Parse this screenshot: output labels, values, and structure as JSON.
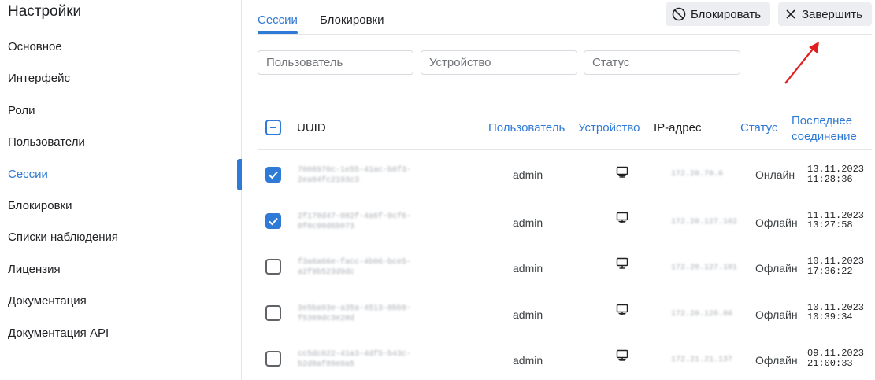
{
  "sidebar": {
    "title": "Настройки",
    "items": [
      {
        "label": "Основное"
      },
      {
        "label": "Интерфейс"
      },
      {
        "label": "Роли"
      },
      {
        "label": "Пользователи"
      },
      {
        "label": "Сессии",
        "active": true
      },
      {
        "label": "Блокировки"
      },
      {
        "label": "Списки наблюдения"
      },
      {
        "label": "Лицензия"
      },
      {
        "label": "Документация"
      },
      {
        "label": "Документация API"
      }
    ]
  },
  "tabs": [
    {
      "label": "Сессии",
      "active": true
    },
    {
      "label": "Блокировки"
    }
  ],
  "toolbar": {
    "block_label": "Блокировать",
    "finish_label": "Завершить"
  },
  "filters": {
    "user_placeholder": "Пользователь",
    "device_placeholder": "Устройство",
    "status_placeholder": "Статус"
  },
  "table": {
    "columns": {
      "uuid": "UUID",
      "user": "Пользователь",
      "device": "Устройство",
      "ip": "IP-адрес",
      "status": "Статус",
      "last_line1": "Последнее",
      "last_line2": "соединение"
    },
    "rows": [
      {
        "checked": true,
        "uuid": "7008970c-1e55-41ac-b8f3-\n2ea04fc2193c3",
        "user": "admin",
        "device_icon": "monitor-icon",
        "ip": "172.20.70.6",
        "status": "Онлайн",
        "date": "13.11.2023",
        "time": "11:28:36"
      },
      {
        "checked": true,
        "uuid": "2f170d47-082f-4a6f-9cf6-\n0f0c90d6b073",
        "user": "admin",
        "device_icon": "monitor-icon",
        "ip": "172.20.127.102",
        "status": "Офлайн",
        "date": "11.11.2023",
        "time": "13:27:58"
      },
      {
        "checked": false,
        "uuid": "f3a6a66e-facc-4b06-bce5-\na2f9b523d9dc",
        "user": "admin",
        "device_icon": "monitor-icon",
        "ip": "172.20.127.101",
        "status": "Офлайн",
        "date": "10.11.2023",
        "time": "17:36:22"
      },
      {
        "checked": false,
        "uuid": "3e5ba93e-a35a-4513-8bb9-\nf5369dc3e28d",
        "user": "admin",
        "device_icon": "monitor-icon",
        "ip": "172.20.120.86",
        "status": "Офлайн",
        "date": "10.11.2023",
        "time": "10:39:34"
      },
      {
        "checked": false,
        "uuid": "cc5dc022-41a3-4df5-b43c-\nb2d8af89e0a5",
        "user": "admin",
        "device_icon": "monitor-icon",
        "ip": "172.21.21.137",
        "status": "Офлайн",
        "date": "09.11.2023",
        "time": "21:00:33"
      }
    ]
  },
  "colors": {
    "accent": "#2f7ad6",
    "annotation_arrow": "#e02020"
  }
}
